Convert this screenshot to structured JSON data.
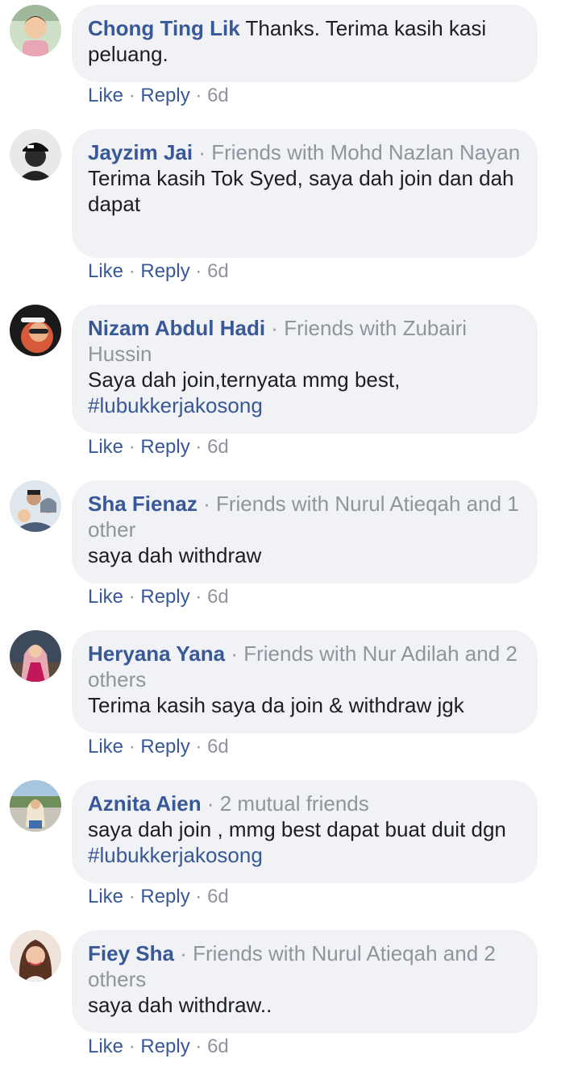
{
  "actions": {
    "like": "Like",
    "reply": "Reply",
    "dot": "·"
  },
  "comments": [
    {
      "author": "Chong Ting Lik",
      "context": "",
      "text": "Thanks. Terima kasih kasi peluang.",
      "tag": "",
      "time": "6d",
      "avatar_icon": "avatar-child-photo",
      "avatar_color": "#d9c7b0"
    },
    {
      "author": "Jayzim Jai",
      "context": "Friends with Mohd Nazlan Nayan",
      "text": "Terima kasih Tok Syed, saya dah join dan dah dapat",
      "tag": "",
      "time": "6d",
      "avatar_icon": "avatar-cap-photo",
      "avatar_color": "#3a3a3a"
    },
    {
      "author": "Nizam Abdul Hadi",
      "context": "Friends with Zubairi Hussin",
      "text": "Saya dah join,ternyata mmg best, ",
      "tag": "#lubukkerjakosong",
      "time": "6d",
      "avatar_icon": "avatar-sunglasses-photo",
      "avatar_color": "#c0392b"
    },
    {
      "author": "Sha Fienaz",
      "context": "Friends with Nurul Atieqah and 1 other",
      "text": "saya dah withdraw",
      "tag": "",
      "time": "6d",
      "avatar_icon": "avatar-family-photo",
      "avatar_color": "#b9c4cf"
    },
    {
      "author": "Heryana Yana",
      "context": "Friends with Nur Adilah and 2 others",
      "text": "Terima kasih saya da join & withdraw jgk",
      "tag": "",
      "time": "6d",
      "avatar_icon": "avatar-hijab-photo",
      "avatar_color": "#8d6e63"
    },
    {
      "author": "Aznita Aien",
      "context": "2 mutual friends",
      "text": "saya dah join , mmg best dapat buat duit dgn ",
      "tag": "#lubukkerjakosong",
      "time": "6d",
      "avatar_icon": "avatar-outdoor-photo",
      "avatar_color": "#7fa7c9"
    },
    {
      "author": "Fiey Sha",
      "context": "Friends with Nurul Atieqah and 2 others",
      "text": "saya dah withdraw..",
      "tag": "",
      "time": "6d",
      "avatar_icon": "avatar-portrait-photo",
      "avatar_color": "#6d4c41"
    }
  ]
}
